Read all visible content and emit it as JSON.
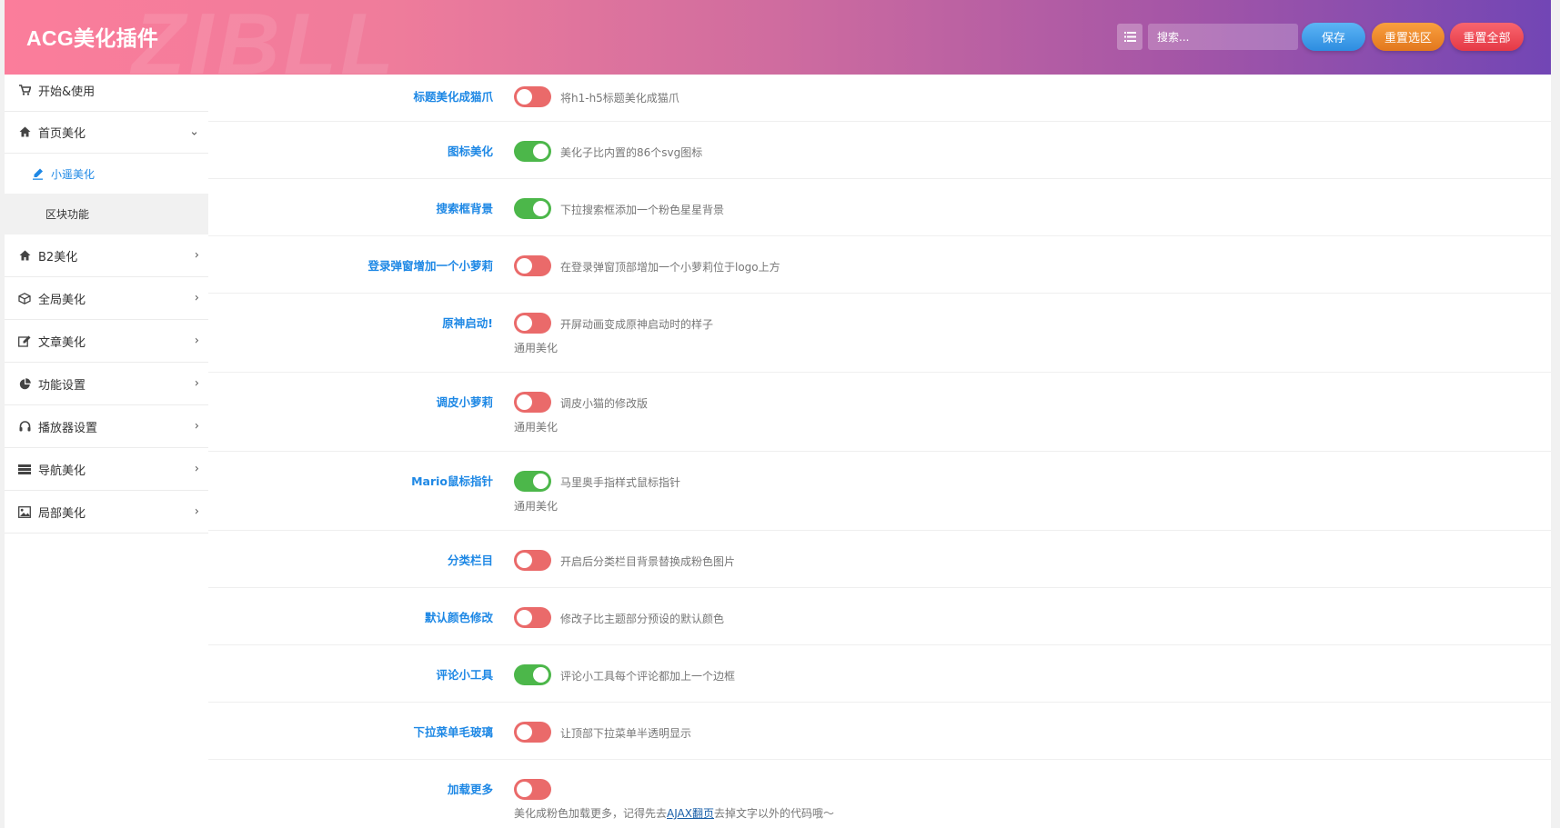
{
  "header": {
    "title": "ACG美化插件",
    "watermark": "ZIBLL",
    "search_placeholder": "搜索...",
    "save_label": "保存",
    "reset_selection_label": "重置选区",
    "reset_all_label": "重置全部"
  },
  "sidebar": {
    "items": [
      {
        "label": "开始&使用",
        "icon": "cart-icon"
      },
      {
        "label": "首页美化",
        "icon": "home-icon",
        "expanded": true
      },
      {
        "label": "B2美化",
        "icon": "home-icon"
      },
      {
        "label": "全局美化",
        "icon": "cube-icon"
      },
      {
        "label": "文章美化",
        "icon": "edit-icon"
      },
      {
        "label": "功能设置",
        "icon": "pie-chart-icon"
      },
      {
        "label": "播放器设置",
        "icon": "headphones-icon"
      },
      {
        "label": "导航美化",
        "icon": "navicon-icon"
      },
      {
        "label": "局部美化",
        "icon": "picture-icon"
      }
    ],
    "subitems": [
      {
        "label": "小遥美化",
        "icon": "pencil-icon",
        "active": true
      },
      {
        "label": "区块功能",
        "active": false
      }
    ]
  },
  "options": [
    {
      "label": "标题美化成猫爪",
      "enabled": false,
      "desc": "将h1-h5标题美化成猫爪"
    },
    {
      "label": "图标美化",
      "enabled": true,
      "desc": "美化子比内置的86个svg图标"
    },
    {
      "label": "搜索框背景",
      "enabled": true,
      "desc": "下拉搜索框添加一个粉色星星背景"
    },
    {
      "label": "登录弹窗增加一个小萝莉",
      "enabled": false,
      "desc": "在登录弹窗顶部增加一个小萝莉位于logo上方"
    },
    {
      "label": "原神启动!",
      "enabled": false,
      "desc": "开屏动画变成原神启动时的样子",
      "sub": "通用美化"
    },
    {
      "label": "调皮小萝莉",
      "enabled": false,
      "desc": "调皮小猫的修改版",
      "sub": "通用美化"
    },
    {
      "label": "Mario鼠标指针",
      "enabled": true,
      "desc": "马里奥手指样式鼠标指针",
      "sub": "通用美化"
    },
    {
      "label": "分类栏目",
      "enabled": false,
      "desc": "开启后分类栏目背景替换成粉色图片"
    },
    {
      "label": "默认颜色修改",
      "enabled": false,
      "desc": "修改子比主题部分预设的默认颜色"
    },
    {
      "label": "评论小工具",
      "enabled": true,
      "desc": "评论小工具每个评论都加上一个边框"
    },
    {
      "label": "下拉菜单毛玻璃",
      "enabled": false,
      "desc": "让顶部下拉菜单半透明显示"
    },
    {
      "label": "加载更多",
      "enabled": false,
      "desc": "",
      "sub_prefix": "美化成粉色加载更多，记得先去",
      "sub_link": "AJAX翻页",
      "sub_suffix": "去掉文字以外的代码哦～"
    }
  ],
  "colors": {
    "accent": "#1e88e5",
    "toggle_on": "#4cb74a",
    "toggle_off": "#ea6a6a",
    "header_gradient": [
      "#fb7d9b",
      "#cf6c9f",
      "#7246b5"
    ]
  }
}
